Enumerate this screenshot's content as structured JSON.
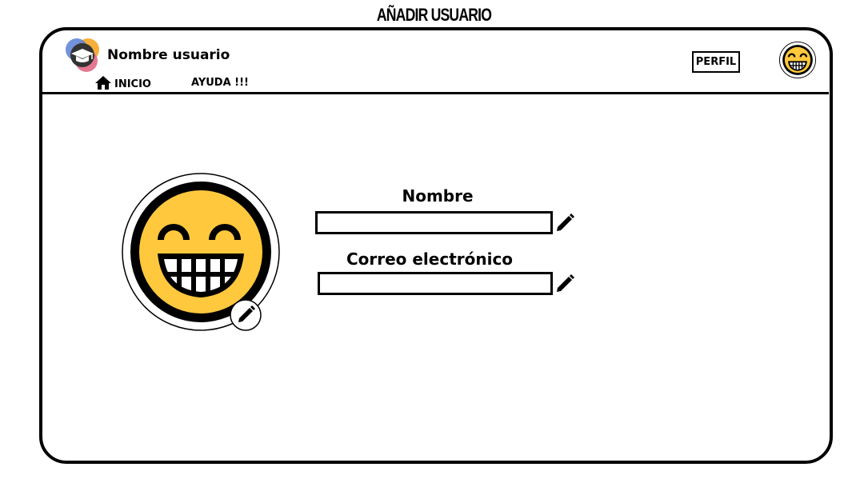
{
  "page": {
    "title": "AÑADIR USUARIO"
  },
  "header": {
    "username": "Nombre usuario",
    "nav": {
      "home_label": "INICIO",
      "help_label": "AYUDA !!!"
    },
    "profile_button_label": "PERFIL"
  },
  "form": {
    "name_label": "Nombre",
    "name_value": "",
    "email_label": "Correo electrónico",
    "email_value": ""
  },
  "colors": {
    "avatar_yellow": "#FFC83D",
    "ink": "#000000"
  },
  "icons": [
    "logo-icon",
    "home-icon",
    "avatar-icon",
    "pencil-icon"
  ]
}
